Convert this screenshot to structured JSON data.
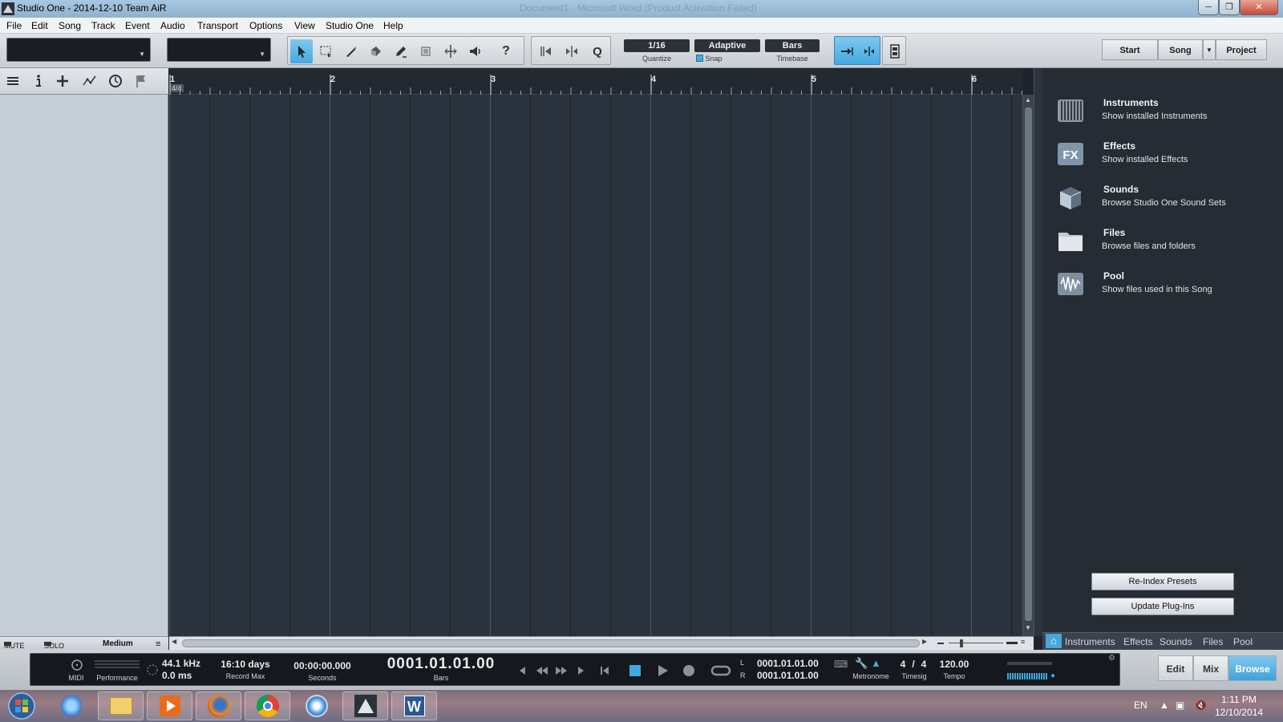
{
  "window": {
    "title": "Studio One - 2014-12-10 Team AiR",
    "ghost_title": "Document1 - Microsoft Word (Product Activation Failed)"
  },
  "menu": [
    "File",
    "Edit",
    "Song",
    "Track",
    "Event",
    "Audio",
    "Transport",
    "Options",
    "View",
    "Studio One",
    "Help"
  ],
  "toolbar": {
    "quantize_value": "1/16",
    "quantize_label": "Quantize",
    "snap_value": "Adaptive",
    "snap_label": "Snap",
    "timebase_value": "Bars",
    "timebase_label": "Timebase",
    "help_label": "?"
  },
  "nav_buttons": {
    "start": "Start",
    "song": "Song",
    "project": "Project"
  },
  "ruler": {
    "bars": [
      "1",
      "2",
      "3",
      "4",
      "5",
      "6"
    ],
    "time_signature": "4/4"
  },
  "browser": {
    "items": [
      {
        "title": "Instruments",
        "desc": "Show installed Instruments"
      },
      {
        "title": "Effects",
        "desc": "Show installed Effects"
      },
      {
        "title": "Sounds",
        "desc": "Browse Studio One Sound Sets"
      },
      {
        "title": "Files",
        "desc": "Browse files and folders"
      },
      {
        "title": "Pool",
        "desc": "Show files used in this Song"
      }
    ],
    "reindex_label": "Re-Index Presets",
    "update_label": "Update Plug-Ins",
    "tabs": [
      "Instruments",
      "Effects",
      "Sounds",
      "Files",
      "Pool"
    ]
  },
  "track_footer": {
    "mute": "MUTE",
    "solo": "SOLO",
    "size": "Medium"
  },
  "transport": {
    "midi_label": "MIDI",
    "performance_label": "Performance",
    "sample_rate": "44.1 kHz",
    "latency": "0.0 ms",
    "record_max_value": "16:10 days",
    "record_max_label": "Record Max",
    "seconds_value": "00:00:00.000",
    "seconds_label": "Seconds",
    "bars_value": "0001.01.01.00",
    "bars_label": "Bars",
    "loop_l_label": "L",
    "loop_r_label": "R",
    "loop_start": "0001.01.01.00",
    "loop_end": "0001.01.01.00",
    "metronome_label": "Metronome",
    "timesig_num": "4",
    "timesig_sep": "/",
    "timesig_den": "4",
    "timesig_label": "Timesig",
    "tempo_value": "120.00",
    "tempo_label": "Tempo"
  },
  "view_buttons": {
    "edit": "Edit",
    "mix": "Mix",
    "browse": "Browse"
  },
  "taskbar": {
    "lang": "EN",
    "time": "1:11 PM",
    "date": "12/10/2014",
    "word_label": "W"
  }
}
